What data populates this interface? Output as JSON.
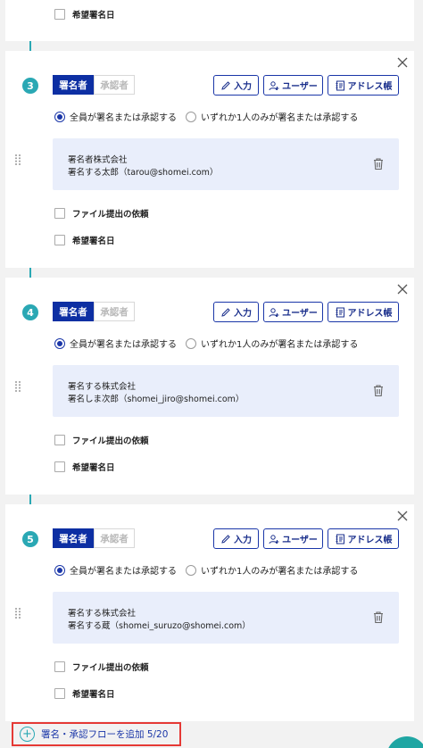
{
  "common": {
    "role_signer": "署名者",
    "role_approver": "承認者",
    "btn_input": "入力",
    "btn_user": "ユーザー",
    "btn_address_book": "アドレス帳",
    "radio_all": "全員が署名または承認する",
    "radio_any": "いずれか1人のみが署名または承認する",
    "check_file_request": "ファイル提出の依頼",
    "check_desired_date": "希望署名日"
  },
  "top_partial": {
    "check_desired_date": "希望署名日"
  },
  "steps": [
    {
      "number": "3",
      "company": "署名者株式会社",
      "person": "署名する太郎（tarou@shomei.com）"
    },
    {
      "number": "4",
      "company": "署名する株式会社",
      "person": "署名しま次郎（shomei_jiro@shomei.com）"
    },
    {
      "number": "5",
      "company": "署名する株式会社",
      "person": "署名する蔵（shomei_suruzo@shomei.com）"
    }
  ],
  "footer": {
    "add_flow_label": "署名・承認フローを追加 5/20"
  },
  "icons": {
    "close": "close-icon",
    "pencil": "pencil-icon",
    "user_add": "user-add-icon",
    "address_book": "address-book-icon",
    "trash": "trash-icon",
    "drag": "drag-handle-icon",
    "plus": "plus-circle-icon"
  },
  "colors": {
    "accent": "#2aa8b4",
    "primary": "#0d2fa3",
    "signer_box": "#e9eefb",
    "highlight_border": "#e53935"
  }
}
